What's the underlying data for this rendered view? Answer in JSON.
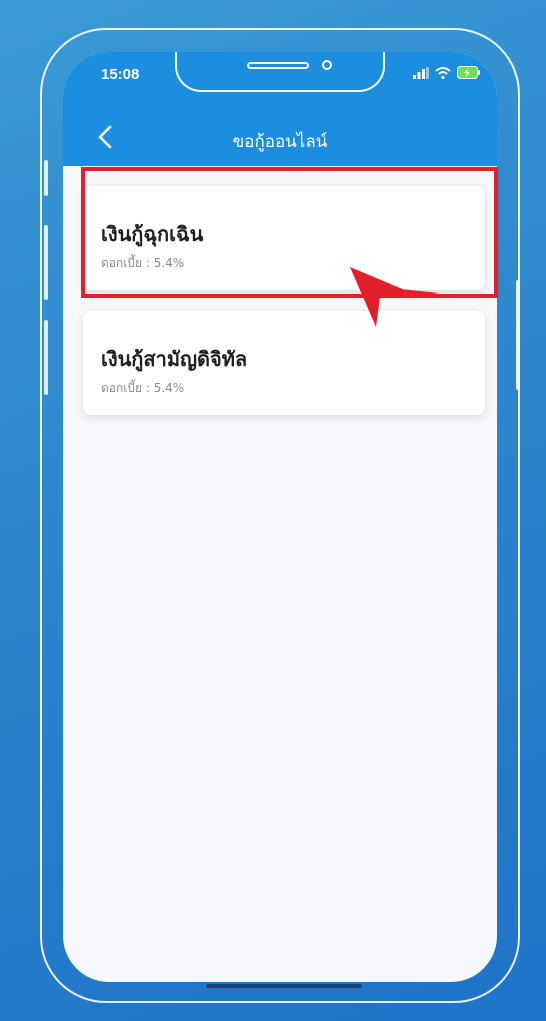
{
  "status_bar": {
    "time": "15:08"
  },
  "header": {
    "title": "ขอกู้ออนไลน์"
  },
  "loans": [
    {
      "title": "เงินกู้ฉุกเฉิน",
      "rate": "ดอกเบี้ย : 5.4%"
    },
    {
      "title": "เงินกู้สามัญดิจิทัล",
      "rate": "ดอกเบี้ย : 5.4%"
    }
  ],
  "colors": {
    "accent": "#1c8edf",
    "highlight": "#e3202a",
    "background": "#2d86cd"
  }
}
